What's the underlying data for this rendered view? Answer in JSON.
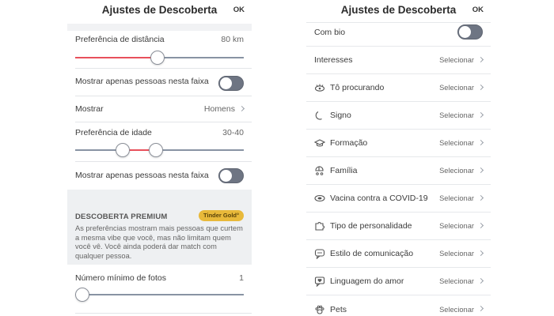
{
  "left": {
    "header": {
      "title": "Ajustes de Descoberta",
      "ok": "OK"
    },
    "distance": {
      "label": "Preferência de distância",
      "value": "80 km",
      "level_fraction": 0.49
    },
    "toggle1": {
      "label": "Mostrar apenas pessoas nesta faixa",
      "on": false
    },
    "show": {
      "label": "Mostrar",
      "value": "Homens"
    },
    "age": {
      "label": "Preferência de idade",
      "value": "30-40",
      "min_fraction": 0.28,
      "max_fraction": 0.48
    },
    "toggle2": {
      "label": "Mostrar apenas pessoas nesta faixa",
      "on": false
    },
    "premium": {
      "title": "DESCOBERTA PREMIUM",
      "badge": "Tinder Gold°",
      "description": "As preferências mostram mais pessoas que curtem a mesma vibe que você, mas não limitam quem você vê. Você ainda poderá dar match com qualquer pessoa."
    },
    "photos": {
      "label": "Número mínimo de fotos",
      "value": "1",
      "level_fraction": 0.0
    }
  },
  "right": {
    "header": {
      "title": "Ajustes de Descoberta",
      "ok": "OK"
    },
    "bio": {
      "label": "Com bio",
      "on": false
    },
    "rows": [
      {
        "label": "Interesses",
        "action": "Selecionar",
        "icon": "none"
      },
      {
        "label": "Tô procurando",
        "action": "Selecionar",
        "icon": "eyes-icon"
      },
      {
        "label": "Signo",
        "action": "Selecionar",
        "icon": "moon-icon"
      },
      {
        "label": "Formação",
        "action": "Selecionar",
        "icon": "graduation-cap-icon"
      },
      {
        "label": "Família",
        "action": "Selecionar",
        "icon": "baby-carriage-icon"
      },
      {
        "label": "Vacina contra a COVID-19",
        "action": "Selecionar",
        "icon": "vaccine-icon"
      },
      {
        "label": "Tipo de personalidade",
        "action": "Selecionar",
        "icon": "puzzle-icon"
      },
      {
        "label": "Estilo de comunicação",
        "action": "Selecionar",
        "icon": "chat-icon"
      },
      {
        "label": "Linguagem do amor",
        "action": "Selecionar",
        "icon": "heart-message-icon"
      },
      {
        "label": "Pets",
        "action": "Selecionar",
        "icon": "paw-icon"
      }
    ]
  },
  "colors": {
    "accent": "#e8505b",
    "track": "#8893a3",
    "toggle_off": "#6e7583",
    "badge_gold": "#e8b93a"
  }
}
